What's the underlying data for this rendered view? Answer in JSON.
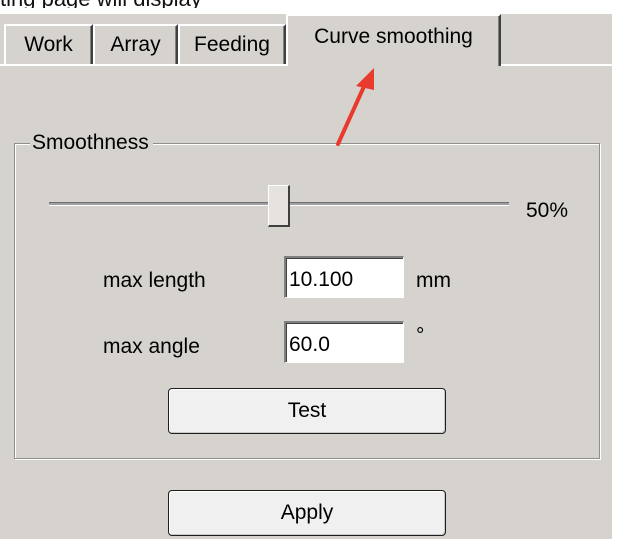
{
  "header_text": "ting page will display",
  "tabs": [
    {
      "label": "Work",
      "active": false
    },
    {
      "label": "Array",
      "active": false
    },
    {
      "label": "Feeding",
      "active": false
    },
    {
      "label": "Curve smoothing",
      "active": true
    }
  ],
  "smoothness": {
    "legend": "Smoothness",
    "slider_value_percent": 50,
    "slider_value_text": "50%"
  },
  "max_length": {
    "label": "max length",
    "value": "10.100",
    "unit": "mm"
  },
  "max_angle": {
    "label": "max angle",
    "value": "60.0",
    "unit": "°"
  },
  "buttons": {
    "test": "Test",
    "apply": "Apply"
  },
  "colors": {
    "panel": "#d6d3ce",
    "annotation_arrow": "#e83a2d"
  }
}
